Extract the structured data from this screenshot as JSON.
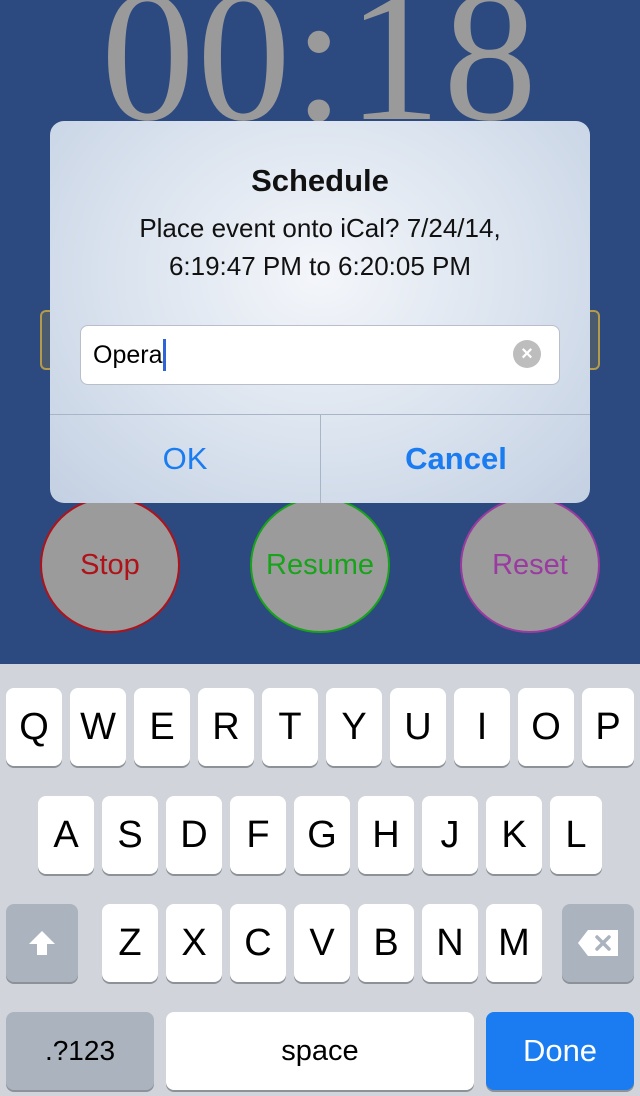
{
  "background": {
    "timer": "00:18",
    "buttons": {
      "stop": "Stop",
      "resume": "Resume",
      "reset": "Reset"
    }
  },
  "alert": {
    "title": "Schedule",
    "message_line1": "Place event onto iCal? 7/24/14,",
    "message_line2": "6:19:47 PM to 6:20:05 PM",
    "input_value": "Opera",
    "ok_label": "OK",
    "cancel_label": "Cancel"
  },
  "keyboard": {
    "row1": [
      "Q",
      "W",
      "E",
      "R",
      "T",
      "Y",
      "U",
      "I",
      "O",
      "P"
    ],
    "row2": [
      "A",
      "S",
      "D",
      "F",
      "G",
      "H",
      "J",
      "K",
      "L"
    ],
    "row3": [
      "Z",
      "X",
      "C",
      "V",
      "B",
      "N",
      "M"
    ],
    "numbers_label": ".?123",
    "space_label": "space",
    "done_label": "Done"
  },
  "colors": {
    "accent": "#1a7cf0",
    "background": "#2c4a80"
  }
}
